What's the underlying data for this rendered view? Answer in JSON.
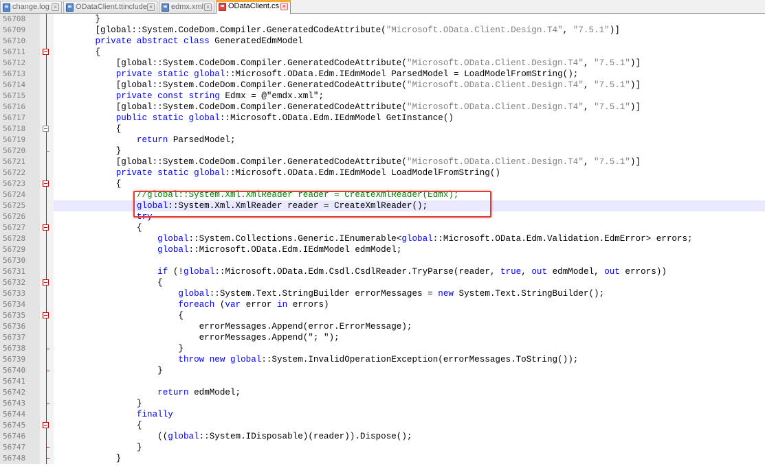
{
  "tabs": [
    {
      "label": "change.log",
      "active": false
    },
    {
      "label": "ODataClient.ttinclude",
      "active": false
    },
    {
      "label": "edmx.xml",
      "active": false
    },
    {
      "label": "ODataClient.cs",
      "active": true
    }
  ],
  "highlight_color": "#e53935",
  "current_line": "56725",
  "lines": [
    {
      "n": "56708",
      "fold": "",
      "tokens": [
        [
          "p",
          "        }"
        ]
      ]
    },
    {
      "n": "56709",
      "fold": "",
      "tokens": [
        [
          "p",
          "        [global::System.CodeDom.Compiler.GeneratedCodeAttribute("
        ],
        [
          "s",
          "\"Microsoft.OData.Client.Design.T4\""
        ],
        [
          "p",
          ", "
        ],
        [
          "s",
          "\"7.5.1\""
        ],
        [
          "p",
          ")]"
        ]
      ]
    },
    {
      "n": "56710",
      "fold": "",
      "tokens": [
        [
          "p",
          "        "
        ],
        [
          "k",
          "private abstract class"
        ],
        [
          "p",
          " GeneratedEdmModel"
        ]
      ]
    },
    {
      "n": "56711",
      "fold": "open",
      "tokens": [
        [
          "p",
          "        {"
        ]
      ]
    },
    {
      "n": "56712",
      "fold": "",
      "tokens": [
        [
          "p",
          "            [global::System.CodeDom.Compiler.GeneratedCodeAttribute("
        ],
        [
          "s",
          "\"Microsoft.OData.Client.Design.T4\""
        ],
        [
          "p",
          ", "
        ],
        [
          "s",
          "\"7.5.1\""
        ],
        [
          "p",
          ")]"
        ]
      ]
    },
    {
      "n": "56713",
      "fold": "",
      "tokens": [
        [
          "p",
          "            "
        ],
        [
          "k",
          "private static"
        ],
        [
          "p",
          " "
        ],
        [
          "k",
          "global"
        ],
        [
          "p",
          "::Microsoft.OData.Edm.IEdmModel ParsedModel = LoadModelFromString();"
        ]
      ]
    },
    {
      "n": "56714",
      "fold": "",
      "tokens": [
        [
          "p",
          "            [global::System.CodeDom.Compiler.GeneratedCodeAttribute("
        ],
        [
          "s",
          "\"Microsoft.OData.Client.Design.T4\""
        ],
        [
          "p",
          ", "
        ],
        [
          "s",
          "\"7.5.1\""
        ],
        [
          "p",
          ")]"
        ]
      ]
    },
    {
      "n": "56715",
      "fold": "",
      "tokens": [
        [
          "p",
          "            "
        ],
        [
          "k",
          "private const string"
        ],
        [
          "p",
          " Edmx = @\"emdx.xml\";"
        ]
      ]
    },
    {
      "n": "56716",
      "fold": "",
      "tokens": [
        [
          "p",
          "            [global::System.CodeDom.Compiler.GeneratedCodeAttribute("
        ],
        [
          "s",
          "\"Microsoft.OData.Client.Design.T4\""
        ],
        [
          "p",
          ", "
        ],
        [
          "s",
          "\"7.5.1\""
        ],
        [
          "p",
          ")]"
        ]
      ]
    },
    {
      "n": "56717",
      "fold": "",
      "tokens": [
        [
          "p",
          "            "
        ],
        [
          "k",
          "public static"
        ],
        [
          "p",
          " "
        ],
        [
          "k",
          "global"
        ],
        [
          "p",
          "::Microsoft.OData.Edm.IEdmModel GetInstance()"
        ]
      ]
    },
    {
      "n": "56718",
      "fold": "open-gray",
      "tokens": [
        [
          "p",
          "            {"
        ]
      ]
    },
    {
      "n": "56719",
      "fold": "",
      "tokens": [
        [
          "p",
          "                "
        ],
        [
          "k",
          "return"
        ],
        [
          "p",
          " ParsedModel;"
        ]
      ]
    },
    {
      "n": "56720",
      "fold": "end-gray",
      "tokens": [
        [
          "p",
          "            }"
        ]
      ]
    },
    {
      "n": "56721",
      "fold": "",
      "tokens": [
        [
          "p",
          "            [global::System.CodeDom.Compiler.GeneratedCodeAttribute("
        ],
        [
          "s",
          "\"Microsoft.OData.Client.Design.T4\""
        ],
        [
          "p",
          ", "
        ],
        [
          "s",
          "\"7.5.1\""
        ],
        [
          "p",
          ")]"
        ]
      ]
    },
    {
      "n": "56722",
      "fold": "",
      "tokens": [
        [
          "p",
          "            "
        ],
        [
          "k",
          "private static"
        ],
        [
          "p",
          " "
        ],
        [
          "k",
          "global"
        ],
        [
          "p",
          "::Microsoft.OData.Edm.IEdmModel LoadModelFromString()"
        ]
      ]
    },
    {
      "n": "56723",
      "fold": "open",
      "tokens": [
        [
          "p",
          "            {"
        ]
      ]
    },
    {
      "n": "56724",
      "fold": "",
      "tokens": [
        [
          "p",
          "                "
        ],
        [
          "c",
          "//global::System.Xml.XmlReader reader = CreateXmlReader(Edmx);"
        ]
      ]
    },
    {
      "n": "56725",
      "fold": "",
      "tokens": [
        [
          "p",
          "                "
        ],
        [
          "k",
          "global"
        ],
        [
          "p",
          "::System.Xml.XmlReader reader = CreateXmlReader();"
        ]
      ]
    },
    {
      "n": "56726",
      "fold": "",
      "tokens": [
        [
          "p",
          "                "
        ],
        [
          "k",
          "try"
        ]
      ]
    },
    {
      "n": "56727",
      "fold": "open",
      "tokens": [
        [
          "p",
          "                {"
        ]
      ]
    },
    {
      "n": "56728",
      "fold": "",
      "tokens": [
        [
          "p",
          "                    "
        ],
        [
          "k",
          "global"
        ],
        [
          "p",
          "::System.Collections.Generic.IEnumerable<"
        ],
        [
          "k",
          "global"
        ],
        [
          "p",
          "::Microsoft.OData.Edm.Validation.EdmError> errors;"
        ]
      ]
    },
    {
      "n": "56729",
      "fold": "",
      "tokens": [
        [
          "p",
          "                    "
        ],
        [
          "k",
          "global"
        ],
        [
          "p",
          "::Microsoft.OData.Edm.IEdmModel edmModel;"
        ]
      ]
    },
    {
      "n": "56730",
      "fold": "",
      "tokens": [
        [
          "p",
          ""
        ]
      ]
    },
    {
      "n": "56731",
      "fold": "",
      "tokens": [
        [
          "p",
          "                    "
        ],
        [
          "k",
          "if"
        ],
        [
          "p",
          " (!"
        ],
        [
          "k",
          "global"
        ],
        [
          "p",
          "::Microsoft.OData.Edm.Csdl.CsdlReader.TryParse(reader, "
        ],
        [
          "k",
          "true"
        ],
        [
          "p",
          ", "
        ],
        [
          "k",
          "out"
        ],
        [
          "p",
          " edmModel, "
        ],
        [
          "k",
          "out"
        ],
        [
          "p",
          " errors))"
        ]
      ]
    },
    {
      "n": "56732",
      "fold": "open",
      "tokens": [
        [
          "p",
          "                    {"
        ]
      ]
    },
    {
      "n": "56733",
      "fold": "",
      "tokens": [
        [
          "p",
          "                        "
        ],
        [
          "k",
          "global"
        ],
        [
          "p",
          "::System.Text.StringBuilder errorMessages = "
        ],
        [
          "k",
          "new"
        ],
        [
          "p",
          " System.Text.StringBuilder();"
        ]
      ]
    },
    {
      "n": "56734",
      "fold": "",
      "tokens": [
        [
          "p",
          "                        "
        ],
        [
          "k",
          "foreach"
        ],
        [
          "p",
          " ("
        ],
        [
          "k",
          "var"
        ],
        [
          "p",
          " error "
        ],
        [
          "k",
          "in"
        ],
        [
          "p",
          " errors)"
        ]
      ]
    },
    {
      "n": "56735",
      "fold": "open",
      "tokens": [
        [
          "p",
          "                        {"
        ]
      ]
    },
    {
      "n": "56736",
      "fold": "",
      "tokens": [
        [
          "p",
          "                            errorMessages.Append(error.ErrorMessage);"
        ]
      ]
    },
    {
      "n": "56737",
      "fold": "",
      "tokens": [
        [
          "p",
          "                            errorMessages.Append(\"; \");"
        ]
      ]
    },
    {
      "n": "56738",
      "fold": "end",
      "tokens": [
        [
          "p",
          "                        }"
        ]
      ]
    },
    {
      "n": "56739",
      "fold": "",
      "tokens": [
        [
          "p",
          "                        "
        ],
        [
          "k",
          "throw new global"
        ],
        [
          "p",
          "::System.InvalidOperationException(errorMessages.ToString());"
        ]
      ]
    },
    {
      "n": "56740",
      "fold": "end",
      "tokens": [
        [
          "p",
          "                    }"
        ]
      ]
    },
    {
      "n": "56741",
      "fold": "",
      "tokens": [
        [
          "p",
          ""
        ]
      ]
    },
    {
      "n": "56742",
      "fold": "",
      "tokens": [
        [
          "p",
          "                    "
        ],
        [
          "k",
          "return"
        ],
        [
          "p",
          " edmModel;"
        ]
      ]
    },
    {
      "n": "56743",
      "fold": "end",
      "tokens": [
        [
          "p",
          "                }"
        ]
      ]
    },
    {
      "n": "56744",
      "fold": "",
      "tokens": [
        [
          "p",
          "                "
        ],
        [
          "k",
          "finally"
        ]
      ]
    },
    {
      "n": "56745",
      "fold": "open",
      "tokens": [
        [
          "p",
          "                {"
        ]
      ]
    },
    {
      "n": "56746",
      "fold": "",
      "tokens": [
        [
          "p",
          "                    (("
        ],
        [
          "k",
          "global"
        ],
        [
          "p",
          "::System.IDisposable)(reader)).Dispose();"
        ]
      ]
    },
    {
      "n": "56747",
      "fold": "end",
      "tokens": [
        [
          "p",
          "                }"
        ]
      ]
    },
    {
      "n": "56748",
      "fold": "end",
      "tokens": [
        [
          "p",
          "            }"
        ]
      ]
    }
  ]
}
